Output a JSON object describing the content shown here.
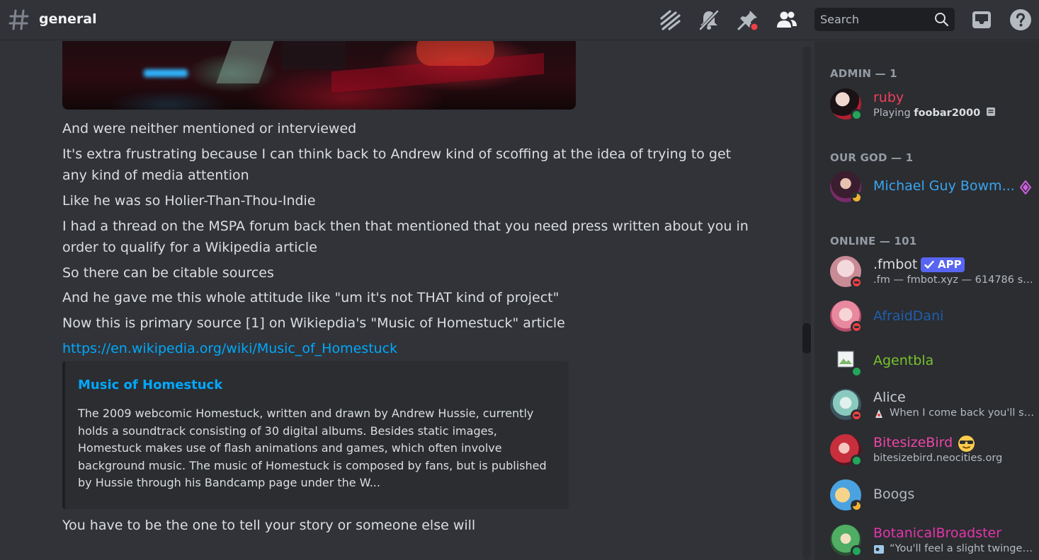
{
  "header": {
    "channel_name": "general",
    "search_placeholder": "Search",
    "icons": [
      "threads-icon",
      "mute-bell-icon",
      "pin-icon",
      "member-list-icon",
      "search-icon",
      "inbox-icon",
      "help-icon"
    ],
    "accent": "#f23f43"
  },
  "chat": {
    "messages": [
      "And were neither mentioned or interviewed",
      "It's extra frustrating because I can think back to Andrew kind of scoffing at the idea of trying to get any kind of media attention",
      "Like he was so Holier-Than-Thou-Indie",
      "I had a thread on the MSPA forum back then that mentioned that you need press written about you in order to qualify for a Wikipedia article",
      "So there can be citable sources",
      "And he gave me this whole attitude like \"um it's not THAT kind of project\"",
      "Now this is primary source [1] on Wikiepdia's \"Music of Homestuck\" article",
      "https://en.wikipedia.org/wiki/Music_of_Homestuck",
      "You have to be the one to tell your story or someone else will"
    ],
    "embed": {
      "title": "Music of Homestuck",
      "description": "The 2009 webcomic Homestuck, written and drawn by Andrew Hussie, currently holds a soundtrack consisting of 30 digital albums. Besides static images, Homestuck makes use of flash animations and games, which often involve background music. The music of Homestuck is composed by fans, but is published by Hussie through his Bandcamp page under the W..."
    },
    "link_color": "#00a8fc"
  },
  "members": {
    "groups": [
      {
        "heading": "ADMIN — 1"
      },
      {
        "heading": "OUR GOD — 1"
      },
      {
        "heading": "ONLINE — 101"
      }
    ],
    "list": [
      {
        "name": "ruby",
        "color": "#f23f5b",
        "status": "online",
        "activity_prefix": "Playing ",
        "activity": "foobar2000"
      },
      {
        "name": "Michael Guy Bowm...",
        "color": "#3aa5f0",
        "status": "idle"
      },
      {
        "name": ".fmbot",
        "color": "#dbdee1",
        "status": "dnd",
        "badge": "APP",
        "sub": ".fm — fmbot.xyz — 614786 ser..."
      },
      {
        "name": "AfraidDani",
        "color": "#1f5fae",
        "status": "dnd"
      },
      {
        "name": "Agentbla",
        "color": "#78c22c",
        "status": "online"
      },
      {
        "name": "Alice",
        "color": "#c9ccd1",
        "status": "dnd",
        "sub": "When I come back you'll st..."
      },
      {
        "name": "BitesizeBird",
        "color": "#ef45a8",
        "status": "online",
        "sub": "bitesizebird.neocities.org"
      },
      {
        "name": "Boogs",
        "color": "#b5bac1",
        "status": "idle"
      },
      {
        "name": "BotanicalBroadster",
        "color": "#e535ab",
        "status": "online",
        "sub": "“You'll feel a slight twinge ..."
      }
    ],
    "status_colors": {
      "online": "#23a55a",
      "idle": "#f0b232",
      "dnd": "#f23f43"
    }
  }
}
